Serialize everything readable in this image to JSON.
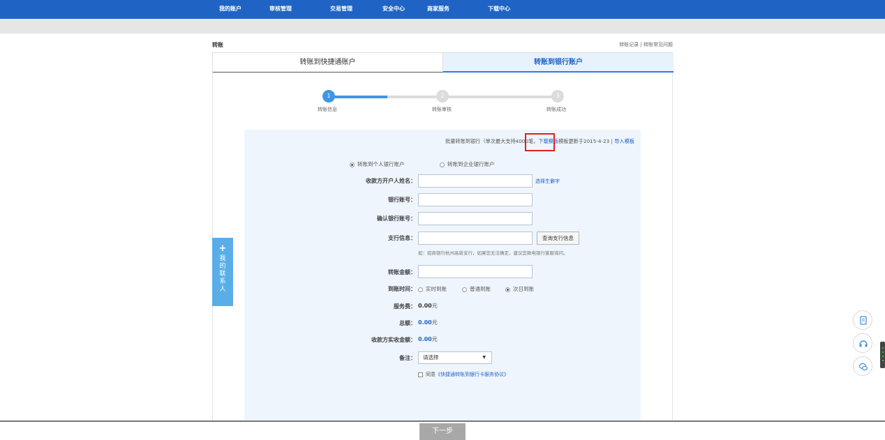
{
  "topnav": {
    "items": [
      "我的账户",
      "审核管理",
      "交易管理",
      "安全中心",
      "商家服务",
      "下载中心"
    ]
  },
  "page": {
    "title": "转账",
    "links": {
      "record": "转账记录",
      "sep": " | ",
      "faq": "转账常见问题"
    }
  },
  "tabs": [
    {
      "label": "转账到快捷通账户",
      "active": false
    },
    {
      "label": "转账到银行账户",
      "active": true
    }
  ],
  "steps": [
    {
      "num": "1",
      "label": "转账信息",
      "state": "current"
    },
    {
      "num": "2",
      "label": "转账审核",
      "state": "pending"
    },
    {
      "num": "3",
      "label": "转账成功",
      "state": "pending"
    }
  ],
  "batch": {
    "prefix": "批量转账到银行（单次最大支持4000笔，",
    "download": "下载模板",
    "updated": "模板更新于2015-4-23 | ",
    "import": "导入模板"
  },
  "account_type": {
    "options": [
      {
        "label": "转账到个人银行账户",
        "selected": true
      },
      {
        "label": "转账到企业银行账户",
        "selected": false
      }
    ]
  },
  "form": {
    "payee_name": {
      "label": "收款方开户人姓名：",
      "value": "",
      "action": "选择生僻字"
    },
    "bank_account": {
      "label": "银行账号：",
      "value": ""
    },
    "confirm_account": {
      "label": "确认银行账号：",
      "value": ""
    },
    "branch": {
      "label": "支行信息：",
      "value": "",
      "button": "查询支行信息",
      "hint": "如：招商银行杭州高新支行，如果您无法确定，建议您致电银行客服询问。"
    },
    "amount": {
      "label": "转账金额：",
      "value": ""
    },
    "arrival": {
      "label": "到账时间：",
      "options": [
        {
          "label": "实时到账",
          "selected": false
        },
        {
          "label": "普通到账",
          "selected": false
        },
        {
          "label": "次日到账",
          "selected": true
        }
      ]
    },
    "fee": {
      "label": "服务费：",
      "value": "0.00",
      "unit": "元"
    },
    "total": {
      "label": "总额：",
      "value": "0.00",
      "unit": "元"
    },
    "received": {
      "label": "收款方实收金额：",
      "value": "0.00",
      "unit": "元"
    },
    "remark": {
      "label": "备注：",
      "selected": "请选择"
    },
    "agree": {
      "label": "同意",
      "link": "《快捷通转账到银行卡服务协议》"
    },
    "next_button": "下一步"
  },
  "contacts_tab": {
    "plus": "+",
    "label": "我的联系人"
  },
  "colors": {
    "nav": "#1f63c4",
    "accent": "#2b7fd9",
    "panel": "#eef5fc",
    "highlight": "#e02020",
    "contacts": "#5aaee8"
  }
}
